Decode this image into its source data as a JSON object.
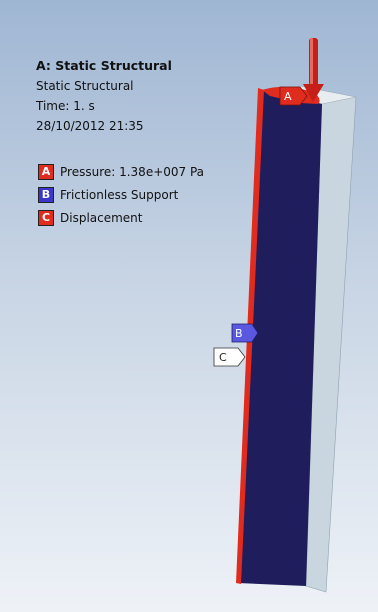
{
  "info": {
    "title": "A: Static Structural",
    "analysis_type": "Static Structural",
    "time": "Time: 1. s",
    "timestamp": "28/10/2012 21:35"
  },
  "legend": [
    {
      "key": "A",
      "label": "Pressure: 1.38e+007 Pa",
      "color": "#e02b1f",
      "text_color": "#ffffff"
    },
    {
      "key": "B",
      "label": "Frictionless Support",
      "color": "#3a37c9",
      "text_color": "#ffffff"
    },
    {
      "key": "C",
      "label": "Displacement",
      "color": "#e02b1f",
      "text_color": "#ffffff"
    }
  ],
  "tags": {
    "a": "A",
    "b": "B",
    "c": "C"
  },
  "colors": {
    "front_face": "#1f1d5c",
    "side_face": "#c9d6e0",
    "top_face": "#e8edf2",
    "pressure": "#e02b1f",
    "support": "#5a57e0"
  }
}
